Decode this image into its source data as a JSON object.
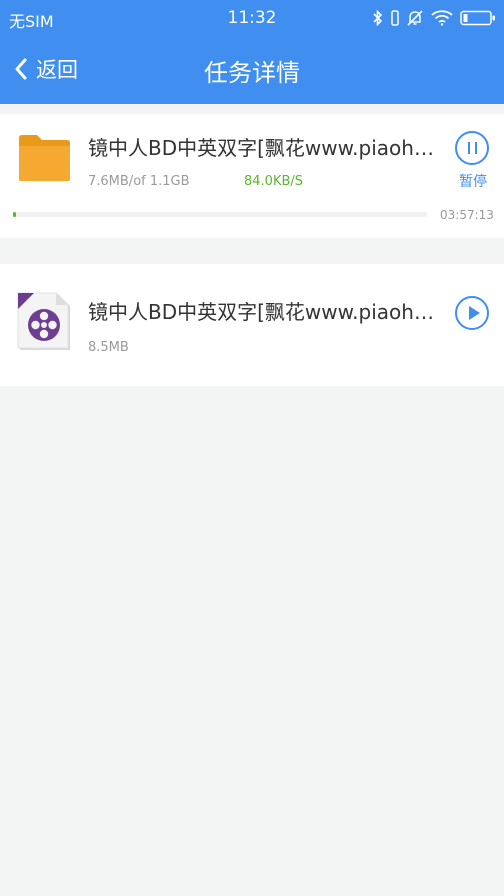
{
  "status_bar": {
    "carrier": "无SIM",
    "time": "11:32"
  },
  "nav": {
    "back_label": "返回",
    "title": "任务详情"
  },
  "tasks": [
    {
      "name": "镜中人BD中英双字[飘花www.piaohua.com].mp4",
      "size": "7.6MB/of 1.1GB",
      "speed": "84.0KB/S",
      "action_label": "暂停",
      "progress": 0.0069,
      "time_left": "03:57:13",
      "icon": "folder-icon",
      "action_icon": "pause-icon"
    },
    {
      "name": "镜中人BD中英双字[飘花www.piaohua.com].mp4",
      "size": "8.5MB",
      "icon": "mp4-video-icon",
      "action_icon": "play-icon"
    }
  ],
  "colors": {
    "accent": "#3f8ef0",
    "progress": "#5cb531",
    "background": "#f3f4f4"
  }
}
